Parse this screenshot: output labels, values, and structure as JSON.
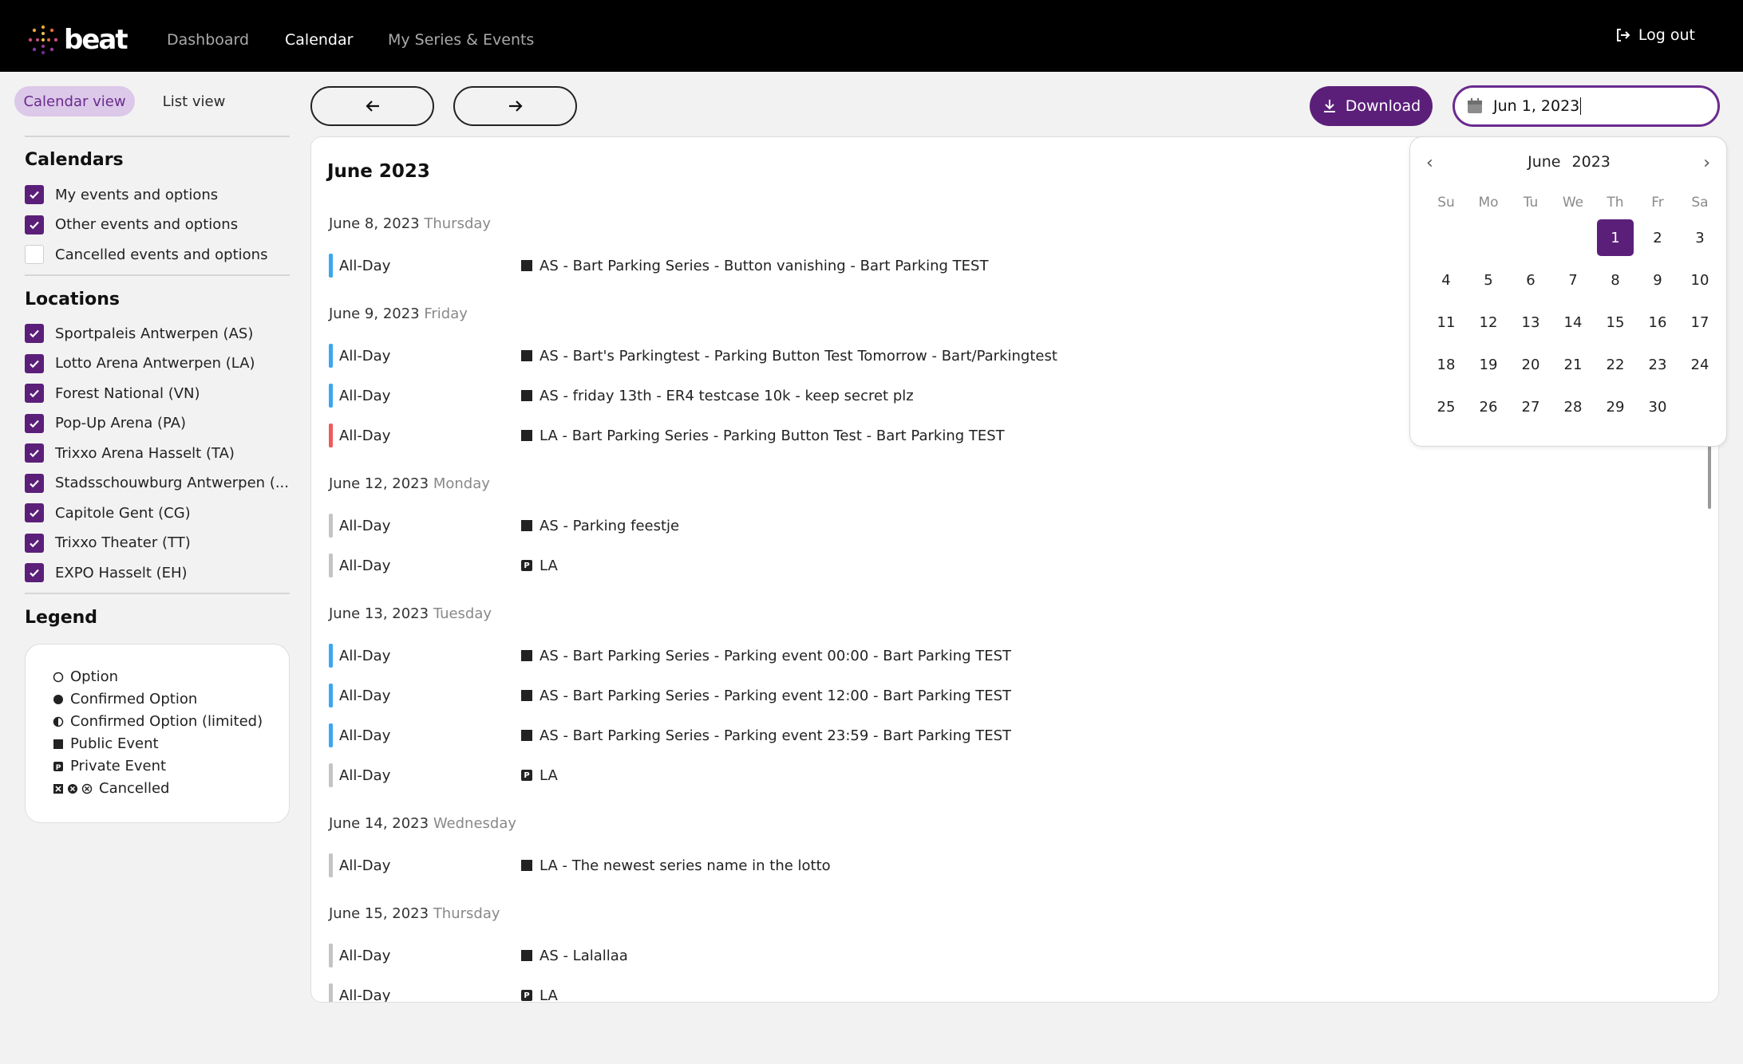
{
  "app": {
    "logo_text": "beat",
    "brand_color": "#5b1f7a"
  },
  "nav": {
    "items": [
      {
        "label": "Dashboard",
        "active": false
      },
      {
        "label": "Calendar",
        "active": true
      },
      {
        "label": "My Series & Events",
        "active": false
      }
    ],
    "logout_label": "Log out"
  },
  "sidebar": {
    "views": {
      "calendar": "Calendar view",
      "list": "List view",
      "active": "calendar"
    },
    "calendars_title": "Calendars",
    "calendars": [
      {
        "label": "My events and options",
        "checked": true
      },
      {
        "label": "Other events and options",
        "checked": true
      },
      {
        "label": "Cancelled events and options",
        "checked": false
      }
    ],
    "locations_title": "Locations",
    "locations": [
      {
        "label": "Sportpaleis Antwerpen (AS)",
        "checked": true
      },
      {
        "label": "Lotto Arena Antwerpen (LA)",
        "checked": true
      },
      {
        "label": "Forest National (VN)",
        "checked": true
      },
      {
        "label": "Pop-Up Arena (PA)",
        "checked": true
      },
      {
        "label": "Trixxo Arena Hasselt (TA)",
        "checked": true
      },
      {
        "label": "Stadsschouwburg Antwerpen (...",
        "checked": true
      },
      {
        "label": "Capitole Gent (CG)",
        "checked": true
      },
      {
        "label": "Trixxo Theater (TT)",
        "checked": true
      },
      {
        "label": "EXPO Hasselt (EH)",
        "checked": true
      }
    ],
    "legend_title": "Legend",
    "legend": [
      {
        "icon": "option-empty-circle-icon",
        "label": "Option"
      },
      {
        "icon": "confirmed-filled-circle-icon",
        "label": "Confirmed Option"
      },
      {
        "icon": "half-circle-icon",
        "label": "Confirmed Option (limited)"
      },
      {
        "icon": "public-square-icon",
        "label": "Public Event"
      },
      {
        "icon": "private-p-icon",
        "label": "Private Event"
      },
      {
        "icon": "cancelled-icons",
        "label": "Cancelled"
      }
    ]
  },
  "toolbar": {
    "prev_icon": "arrow-left-icon",
    "next_icon": "arrow-right-icon",
    "download_label": "Download",
    "date_value": "Jun 1, 2023"
  },
  "calendar": {
    "month_title": "June 2023",
    "days": [
      {
        "date": "June 8, 2023",
        "dow": "Thursday",
        "events": [
          {
            "time": "All-Day",
            "type": "public",
            "bar_color": "#3aa7f0",
            "title": "AS - Bart Parking Series - Button vanishing - Bart Parking TEST"
          }
        ]
      },
      {
        "date": "June 9, 2023",
        "dow": "Friday",
        "events": [
          {
            "time": "All-Day",
            "type": "public",
            "bar_color": "#3aa7f0",
            "title": "AS - Bart's Parkingtest - Parking Button Test Tomorrow - Bart/Parkingtest"
          },
          {
            "time": "All-Day",
            "type": "public",
            "bar_color": "#3aa7f0",
            "title": "AS - friday 13th - ER4 testcase 10k - keep secret plz"
          },
          {
            "time": "All-Day",
            "type": "public",
            "bar_color": "#ef5a5a",
            "title": "LA - Bart Parking Series - Parking Button Test - Bart Parking TEST"
          }
        ]
      },
      {
        "date": "June 12, 2023",
        "dow": "Monday",
        "events": [
          {
            "time": "All-Day",
            "type": "public",
            "bar_color": "#c4c4c4",
            "title": "AS - Parking feestje"
          },
          {
            "time": "All-Day",
            "type": "private",
            "bar_color": "#c4c4c4",
            "title": "LA"
          }
        ]
      },
      {
        "date": "June 13, 2023",
        "dow": "Tuesday",
        "events": [
          {
            "time": "All-Day",
            "type": "public",
            "bar_color": "#3aa7f0",
            "title": "AS - Bart Parking Series - Parking event 00:00 - Bart Parking TEST"
          },
          {
            "time": "All-Day",
            "type": "public",
            "bar_color": "#3aa7f0",
            "title": "AS - Bart Parking Series - Parking event 12:00 - Bart Parking TEST"
          },
          {
            "time": "All-Day",
            "type": "public",
            "bar_color": "#3aa7f0",
            "title": "AS - Bart Parking Series - Parking event 23:59 - Bart Parking TEST"
          },
          {
            "time": "All-Day",
            "type": "private",
            "bar_color": "#c4c4c4",
            "title": "LA"
          }
        ]
      },
      {
        "date": "June 14, 2023",
        "dow": "Wednesday",
        "events": [
          {
            "time": "All-Day",
            "type": "public",
            "bar_color": "#c4c4c4",
            "title": "LA - The newest series name in the lotto"
          }
        ]
      },
      {
        "date": "June 15, 2023",
        "dow": "Thursday",
        "events": [
          {
            "time": "All-Day",
            "type": "public",
            "bar_color": "#c4c4c4",
            "title": "AS - Lalallaa"
          },
          {
            "time": "All-Day",
            "type": "private",
            "bar_color": "#c4c4c4",
            "title": "LA"
          }
        ]
      }
    ]
  },
  "datepicker": {
    "month": "June",
    "year": "2023",
    "prev_icon": "chevron-left-icon",
    "next_icon": "chevron-right-icon",
    "weekdays": [
      "Su",
      "Mo",
      "Tu",
      "We",
      "Th",
      "Fr",
      "Sa"
    ],
    "first_weekday_index": 4,
    "days_in_month": 30,
    "selected_day": 1
  }
}
